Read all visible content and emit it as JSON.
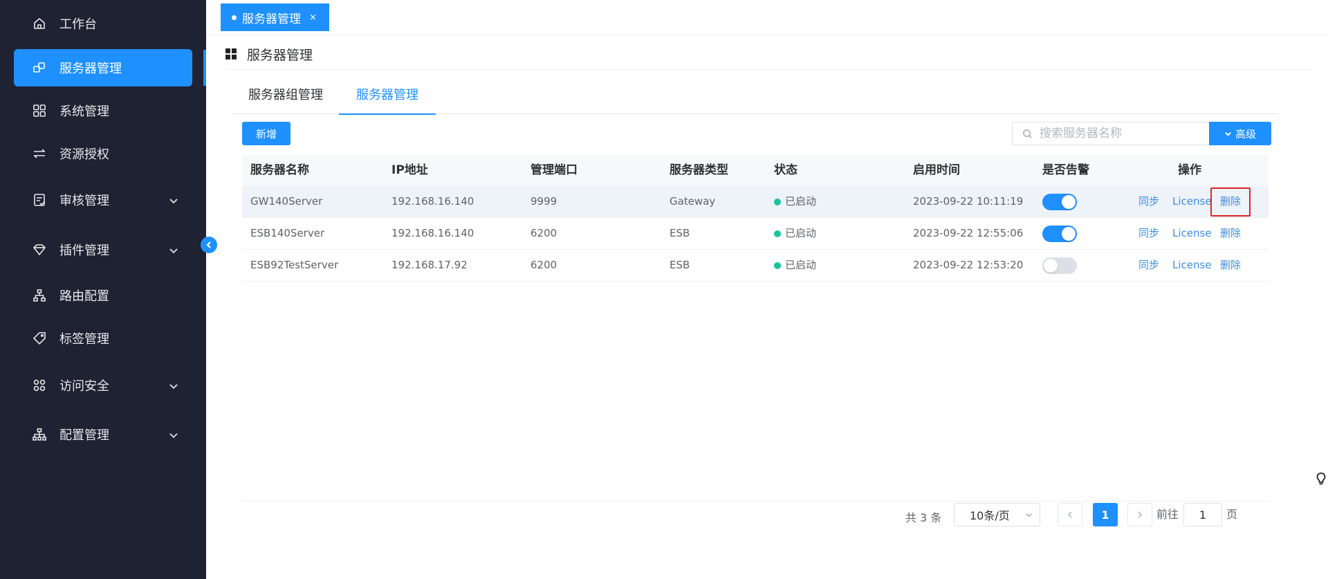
{
  "sidebar": {
    "items": [
      {
        "label": "工作台",
        "icon": "home-icon"
      },
      {
        "label": "服务器管理",
        "icon": "server-icon",
        "active": true
      },
      {
        "label": "系统管理",
        "icon": "grid-icon"
      },
      {
        "label": "资源授权",
        "icon": "transfer-icon"
      },
      {
        "label": "审核管理",
        "icon": "audit-icon",
        "expandable": true
      },
      {
        "label": "插件管理",
        "icon": "diamond-icon",
        "expandable": true
      },
      {
        "label": "路由配置",
        "icon": "route-icon"
      },
      {
        "label": "标签管理",
        "icon": "tag-icon"
      },
      {
        "label": "访问安全",
        "icon": "security-icon",
        "expandable": true
      },
      {
        "label": "配置管理",
        "icon": "config-icon",
        "expandable": true
      }
    ]
  },
  "tabs": {
    "open_tab": {
      "label": "服务器管理",
      "close": "×"
    }
  },
  "page": {
    "title": "服务器管理"
  },
  "subtabs": [
    {
      "label": "服务器组管理"
    },
    {
      "label": "服务器管理",
      "active": true
    }
  ],
  "toolbar": {
    "add_label": "新增",
    "search_placeholder": "搜索服务器名称",
    "advanced_label": "高级"
  },
  "table": {
    "columns": [
      "服务器名称",
      "IP地址",
      "管理端口",
      "服务器类型",
      "状态",
      "启用时间",
      "是否告警",
      "操作"
    ],
    "rows": [
      {
        "name": "GW140Server",
        "ip": "192.168.16.140",
        "port": "9999",
        "type": "Gateway",
        "status": "已启动",
        "time": "2023-09-22 10:11:19",
        "alarm": true
      },
      {
        "name": "ESB140Server",
        "ip": "192.168.16.140",
        "port": "6200",
        "type": "ESB",
        "status": "已启动",
        "time": "2023-09-22 12:55:06",
        "alarm": true
      },
      {
        "name": "ESB92TestServer",
        "ip": "192.168.17.92",
        "port": "6200",
        "type": "ESB",
        "status": "已启动",
        "time": "2023-09-22 12:53:20",
        "alarm": false
      }
    ],
    "ops": {
      "sync": "同步",
      "license": "License",
      "delete": "删除"
    }
  },
  "pagination": {
    "total": "共 3 条",
    "page_size": "10条/页",
    "current_page": "1",
    "goto_prefix": "前往",
    "goto_value": "1",
    "goto_suffix": "页"
  },
  "colors": {
    "sidebar_bg": "#1f2232",
    "accent": "#1e90ff",
    "status_running": "#19c49a",
    "highlight_border": "#e02424"
  }
}
